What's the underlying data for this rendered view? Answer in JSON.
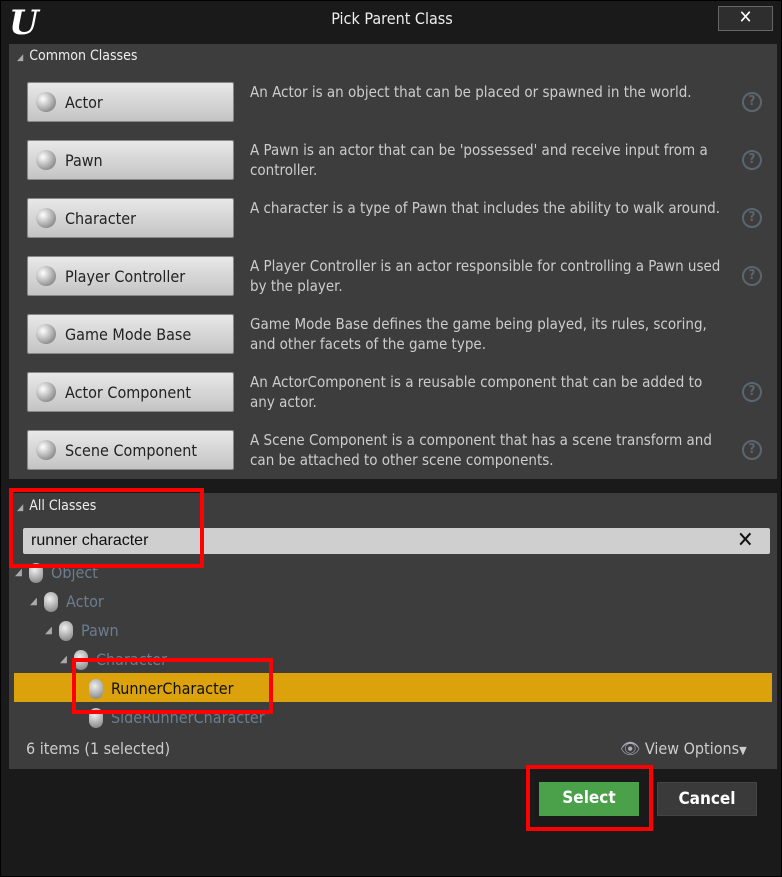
{
  "window": {
    "title": "Pick Parent Class",
    "logo": "U",
    "close_icon": "close-icon"
  },
  "common": {
    "header": "Common Classes",
    "items": [
      {
        "label": "Actor",
        "desc": "An Actor is an object that can be placed or spawned in the world.",
        "help": true
      },
      {
        "label": "Pawn",
        "desc": "A Pawn is an actor that can be 'possessed' and receive input from a controller.",
        "help": true
      },
      {
        "label": "Character",
        "desc": "A character is a type of Pawn that includes the ability to walk around.",
        "help": true
      },
      {
        "label": "Player Controller",
        "desc": "A Player Controller is an actor responsible for controlling a Pawn used by the player.",
        "help": true
      },
      {
        "label": "Game Mode Base",
        "desc": "Game Mode Base defines the game being played, its rules, scoring, and other facets of the game type.",
        "help": false
      },
      {
        "label": "Actor Component",
        "desc": "An ActorComponent is a reusable component that can be added to any actor.",
        "help": true
      },
      {
        "label": "Scene Component",
        "desc": "A Scene Component is a component that has a scene transform and can be attached to other scene components.",
        "help": true
      }
    ]
  },
  "all": {
    "header": "All Classes",
    "search_value": "runner character",
    "tree": [
      {
        "label": "Object",
        "depth": 0,
        "expanded": true
      },
      {
        "label": "Actor",
        "depth": 1,
        "expanded": true
      },
      {
        "label": "Pawn",
        "depth": 2,
        "expanded": true
      },
      {
        "label": "Character",
        "depth": 3,
        "expanded": true
      },
      {
        "label": "RunnerCharacter",
        "depth": 4,
        "selected": true
      },
      {
        "label": "SideRunnerCharacter",
        "depth": 4
      }
    ],
    "status": "6 items (1 selected)",
    "view_options": "View Options"
  },
  "buttons": {
    "select": "Select",
    "cancel": "Cancel"
  },
  "colors": {
    "selected_row": "#dca20c",
    "select_button": "#4aa14a",
    "highlight": "#ff0000"
  }
}
